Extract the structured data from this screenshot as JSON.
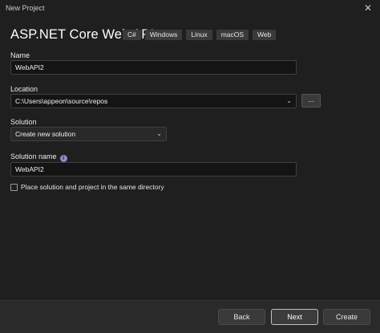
{
  "window": {
    "title": "New Project",
    "close_glyph": "✕"
  },
  "header": {
    "template_name": "ASP.NET Core Web API",
    "tags": [
      "C#",
      "Windows",
      "Linux",
      "macOS",
      "Web"
    ]
  },
  "form": {
    "name": {
      "label": "Name",
      "value": "WebAPI2"
    },
    "location": {
      "label": "Location",
      "value": "C:\\Users\\appeon\\source\\repos",
      "browse_label": "..."
    },
    "solution": {
      "label": "Solution",
      "value": "Create new solution"
    },
    "solution_name": {
      "label": "Solution name",
      "info_glyph": "i",
      "value": "WebAPI2"
    },
    "same_directory": {
      "label": "Place solution and project in the same directory",
      "checked": false
    }
  },
  "footer": {
    "back_label": "Back",
    "next_label": "Next",
    "create_label": "Create"
  },
  "icons": {
    "dropdown": "chevron-down-icon",
    "info": "info-icon",
    "close": "close-icon"
  },
  "colors": {
    "background": "#1f1f1f",
    "accent": "#8a8fc9"
  }
}
